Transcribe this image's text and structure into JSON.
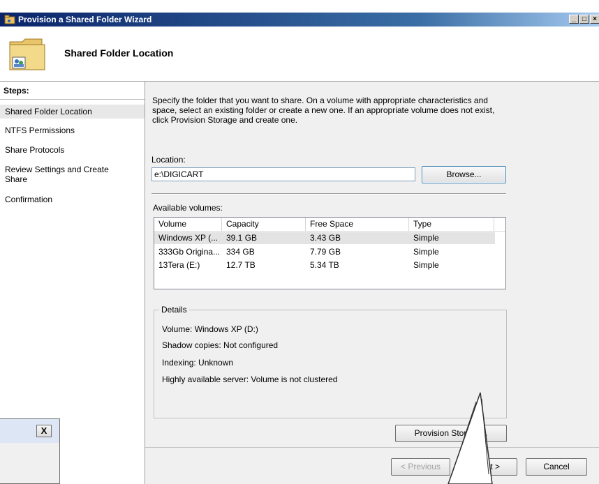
{
  "window": {
    "title": "Provision a Shared Folder Wizard",
    "minimize": "_",
    "maximize": "□",
    "close": "×"
  },
  "header": {
    "title": "Shared Folder Location"
  },
  "steps": {
    "title": "Steps:",
    "items": [
      {
        "label": "Shared Folder Location"
      },
      {
        "label": "NTFS Permissions"
      },
      {
        "label": "Share Protocols"
      },
      {
        "label": "Review Settings and Create Share"
      },
      {
        "label": "Confirmation"
      }
    ]
  },
  "page": {
    "description": "Specify the folder that you want to share. On a volume with appropriate characteristics and space, select an existing folder or create a new one. If an appropriate volume does not exist, click Provision Storage and create one.",
    "location_label": "Location:",
    "location_value": "e:\\DIGICART",
    "browse_label": "Browse...",
    "volumes_label": "Available volumes:",
    "volumes": {
      "columns": [
        "Volume",
        "Capacity",
        "Free Space",
        "Type"
      ],
      "rows": [
        [
          "Windows XP (...",
          "39.1 GB",
          "3.43 GB",
          "Simple"
        ],
        [
          "333Gb Origina...",
          "334 GB",
          "7.79 GB",
          "Simple"
        ],
        [
          "13Tera (E:)",
          "12.7 TB",
          "5.34 TB",
          "Simple"
        ]
      ]
    },
    "details": {
      "legend": "Details",
      "volume": "Volume:   Windows XP (D:)",
      "shadow": "Shadow copies:   Not configured",
      "indexing": "Indexing:   Unknown",
      "ha": "Highly available server:   Volume is not clustered"
    },
    "provision_label": "Provision Storage..."
  },
  "buttons": {
    "previous": "< Previous",
    "next": "Next >",
    "cancel": "Cancel"
  },
  "popup": {
    "close": "X"
  },
  "colors": {
    "titlebar": "#0a246a",
    "panel": "#f0f0f0",
    "selection": "#e3e3e3"
  }
}
